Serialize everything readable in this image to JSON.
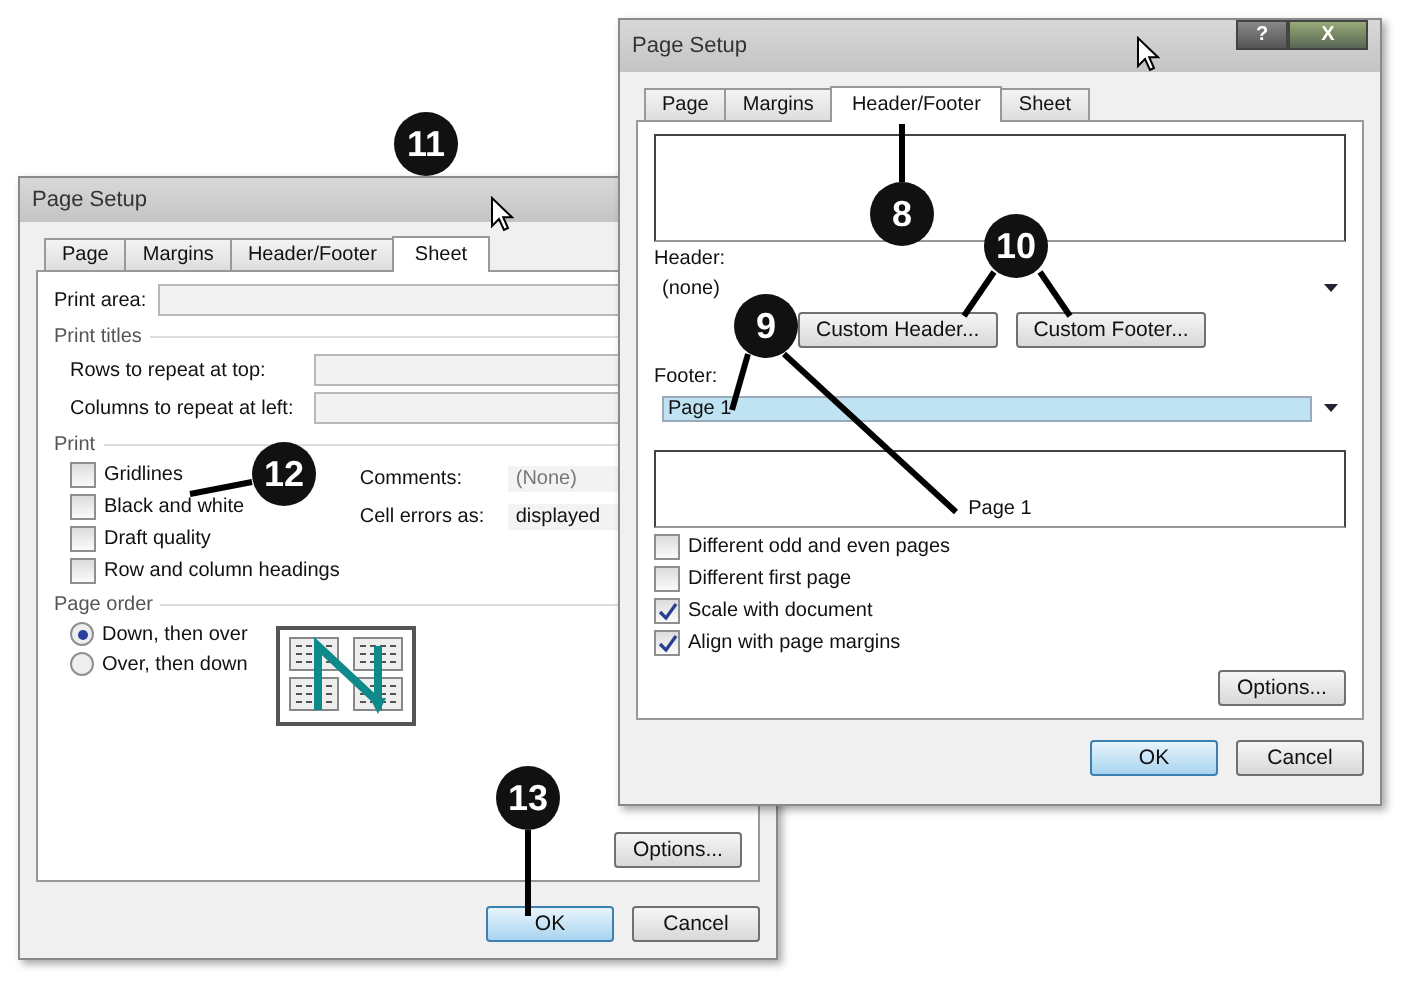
{
  "back_dialog": {
    "title": "Page Setup",
    "tabs": [
      {
        "label": "Page",
        "selected": false
      },
      {
        "label": "Margins",
        "selected": false
      },
      {
        "label": "Header/Footer",
        "selected": false
      },
      {
        "label": "Sheet",
        "selected": true
      }
    ],
    "print_area_label": "Print area:",
    "print_titles_heading": "Print titles",
    "rows_label": "Rows to repeat at top:",
    "columns_label": "Columns to repeat at left:",
    "print_heading": "Print",
    "print_options": [
      {
        "label": "Gridlines",
        "checked": false
      },
      {
        "label": "Black and white",
        "checked": false
      },
      {
        "label": "Draft quality",
        "checked": false
      },
      {
        "label": "Row and column headings",
        "checked": false
      }
    ],
    "comments_label": "Comments:",
    "comments_value": "(None)",
    "cell_errors_label": "Cell errors as:",
    "cell_errors_value": "displayed",
    "page_order_heading": "Page order",
    "page_order": [
      {
        "label": "Down, then over",
        "selected": true
      },
      {
        "label": "Over, then down",
        "selected": false
      }
    ],
    "options_button": "Options...",
    "ok_button": "OK",
    "cancel_button": "Cancel"
  },
  "front_dialog": {
    "title": "Page Setup",
    "help_button": "?",
    "close_button": "X",
    "tabs": [
      {
        "label": "Page",
        "selected": false
      },
      {
        "label": "Margins",
        "selected": false
      },
      {
        "label": "Header/Footer",
        "selected": true
      },
      {
        "label": "Sheet",
        "selected": false
      }
    ],
    "header_label": "Header:",
    "header_value": "(none)",
    "custom_header_button": "Custom Header...",
    "custom_footer_button": "Custom Footer...",
    "footer_label": "Footer:",
    "footer_value": "Page 1",
    "footer_preview": "Page 1",
    "options": [
      {
        "label": "Different odd and even pages",
        "checked": false
      },
      {
        "label": "Different first page",
        "checked": false
      },
      {
        "label": "Scale with document",
        "checked": true
      },
      {
        "label": "Align with page margins",
        "checked": true
      }
    ],
    "options_button": "Options...",
    "ok_button": "OK",
    "cancel_button": "Cancel"
  },
  "callouts": [
    {
      "number": "11"
    },
    {
      "number": "8"
    },
    {
      "number": "10"
    },
    {
      "number": "9"
    },
    {
      "number": "12"
    },
    {
      "number": "13"
    }
  ]
}
